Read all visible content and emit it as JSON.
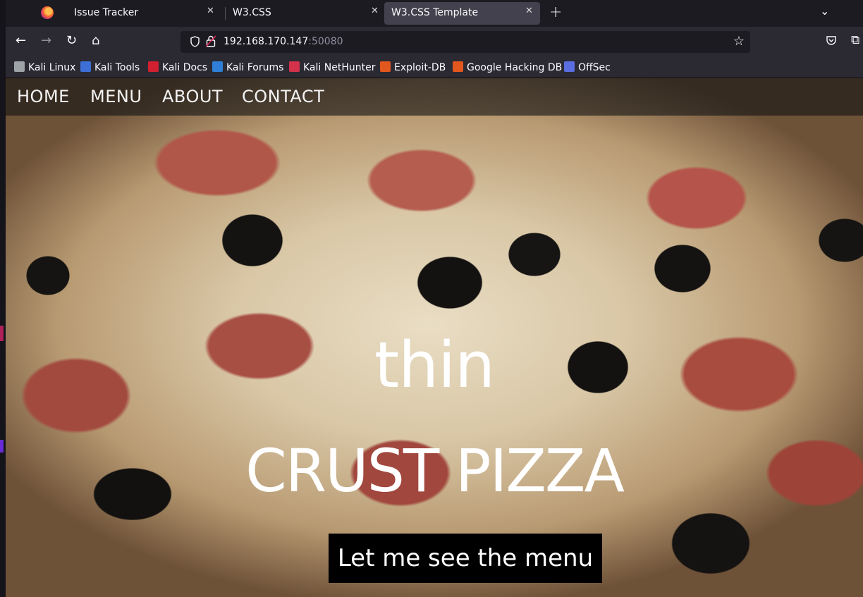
{
  "browser": {
    "tabs": [
      {
        "label": "Issue Tracker",
        "active": false
      },
      {
        "label": "W3.CSS",
        "active": false
      },
      {
        "label": "W3.CSS Template",
        "active": true
      }
    ],
    "new_tab_symbol": "+",
    "url_host": "192.168.170.147",
    "url_port": ":50080",
    "bookmarks": [
      {
        "label": "Kali Linux",
        "icon": "kali-dragon-icon",
        "color": "#9ea3a8"
      },
      {
        "label": "Kali Tools",
        "icon": "kali-tools-icon",
        "color": "#3d6fd6"
      },
      {
        "label": "Kali Docs",
        "icon": "kali-docs-icon",
        "color": "#d1202f"
      },
      {
        "label": "Kali Forums",
        "icon": "kali-forums-icon",
        "color": "#2f7fd8"
      },
      {
        "label": "Kali NetHunter",
        "icon": "nethunter-icon",
        "color": "#d3324a"
      },
      {
        "label": "Exploit-DB",
        "icon": "exploit-db-icon",
        "color": "#e2571e"
      },
      {
        "label": "Google Hacking DB",
        "icon": "ghdb-icon",
        "color": "#e2571e"
      },
      {
        "label": "OffSec",
        "icon": "offsec-icon",
        "color": "#5b6ee1"
      }
    ]
  },
  "site": {
    "nav": [
      "HOME",
      "MENU",
      "ABOUT",
      "CONTACT"
    ],
    "hero_line1": "thin",
    "hero_line2": "CRUST PIZZA",
    "cta_label": "Let me see the menu"
  }
}
